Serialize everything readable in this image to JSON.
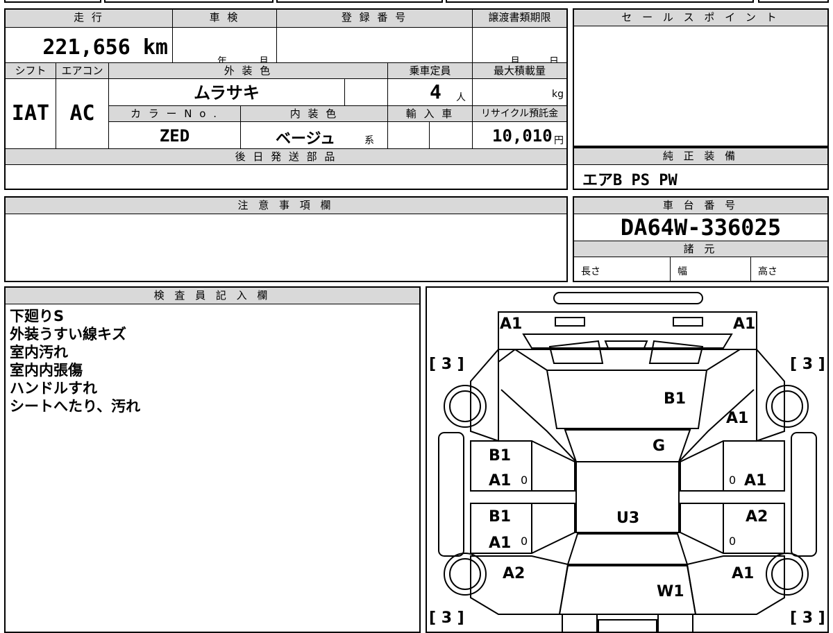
{
  "labels": {
    "mileage": "走 行",
    "inspection": "車 検",
    "registration_number": "登 録 番 号",
    "transfer_deadline": "譲渡書類期限",
    "sales_point": "セ ー ル ス ポ イ ン ト",
    "shift": "シフト",
    "aircon": "エアコン",
    "exterior_color": "外 装 色",
    "capacity": "乗車定員",
    "max_load": "最大積載量",
    "color_no": "カ ラ ー N o .",
    "interior_color": "内 装 色",
    "imported": "輸 入 車",
    "recycle": "リサイクル預託金",
    "later_parts": "後 日 発 送 部 品",
    "genuine_equipment": "純 正 装 備",
    "notes": "注 意 事 項 欄",
    "chassis_number": "車 台 番 号",
    "specs": "諸 元",
    "length": "長さ",
    "width": "幅",
    "height": "高さ",
    "inspector": "検 査 員 記 入 欄",
    "year": "年",
    "month": "月",
    "month2": "月",
    "day": "日",
    "person_unit": "人",
    "kg": "kg",
    "yen": "円",
    "kei": "系"
  },
  "values": {
    "mileage": "221,656 km",
    "shift": "IAT",
    "aircon": "AC",
    "exterior_color": "ムラサキ",
    "capacity": "4",
    "color_no": "ZED",
    "interior_color": "ベージュ",
    "recycle": "10,010",
    "genuine_equipment": "エアB PS PW",
    "chassis_number": "DA64W-336025"
  },
  "inspector_notes": [
    "下廻りS",
    "外装うすい線キズ",
    "室内汚れ",
    "室内内張傷",
    "ハンドルすれ",
    "シートへたり、汚れ"
  ],
  "diagram_marks": {
    "front_left": "A1",
    "front_right": "A1",
    "bracket_tl": "[ 3 ]",
    "bracket_tr": "[ 3 ]",
    "bracket_bl": "[ 3 ]",
    "bracket_br": "[ 3 ]",
    "hood": "B1",
    "fender_r": "A1",
    "windshield": "G",
    "door_lf_1": "B1",
    "door_lf_2": "A1",
    "door_lr_1": "B1",
    "door_lr_2": "A1",
    "door_rf": "A1",
    "door_rr": "A2",
    "roof": "U3",
    "quarter_l": "A2",
    "quarter_r": "A1",
    "rear_glass": "W1",
    "zero": "0"
  }
}
